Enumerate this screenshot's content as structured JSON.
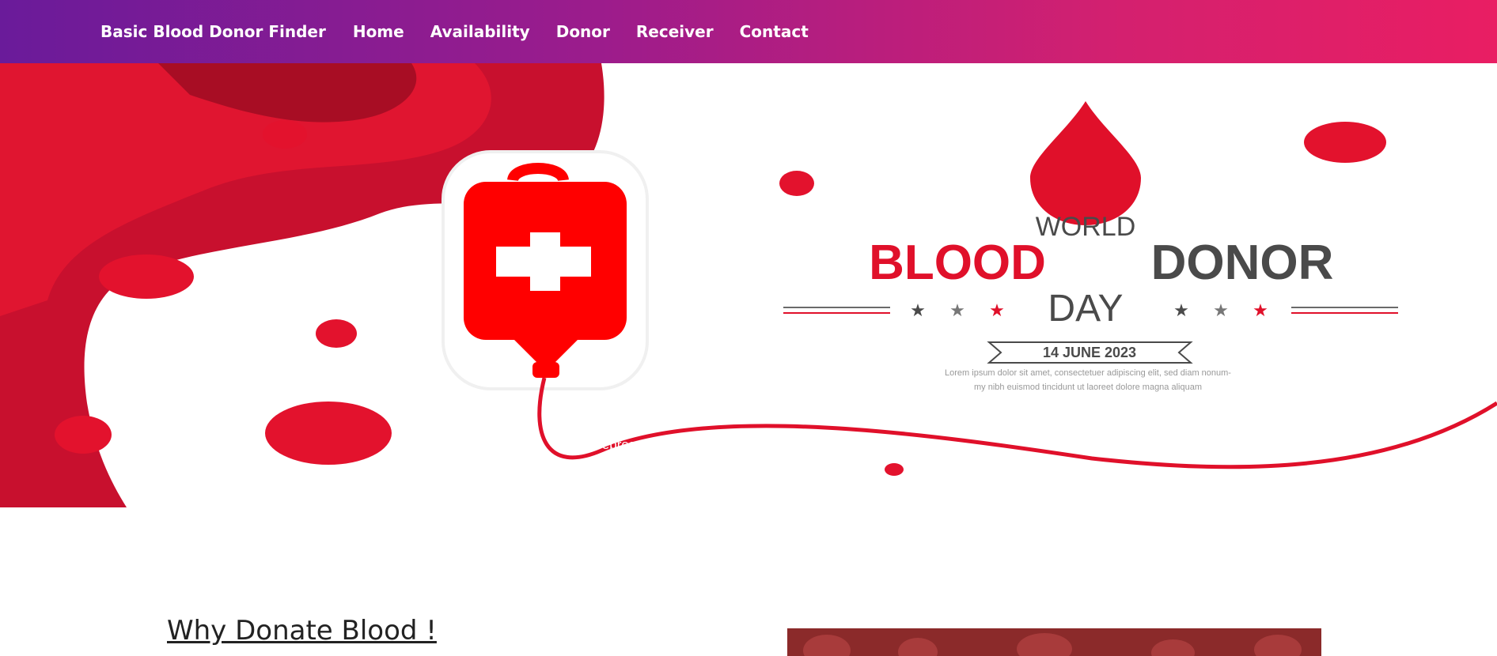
{
  "navbar": {
    "brand": "Basic Blood Donor Finder",
    "links": [
      {
        "label": "Home"
      },
      {
        "label": "Availability"
      },
      {
        "label": "Donor"
      },
      {
        "label": "Receiver"
      },
      {
        "label": "Contact"
      }
    ],
    "gradient_start": "#6a1b9a",
    "gradient_end": "#e91e63"
  },
  "hero": {
    "banner_line1": "WORLD",
    "banner_word_red": "BLOOD",
    "banner_word_grey": "DONOR",
    "banner_line3": "DAY",
    "date_ribbon": "14 JUNE 2023",
    "lorem_line1": "Lorem ipsum dolor sit amet, consectetuer adipiscing elit, sed diam nonum-",
    "lorem_line2": "my nibh euismod tincidunt ut laoreet dolore magna aliquam",
    "caption": "Some representative placeholder content",
    "prev_icon": "chevron-left-icon",
    "accent_red": "#e0102a",
    "grey": "#4a4a4a"
  },
  "section": {
    "title": "Why Donate Blood !"
  }
}
